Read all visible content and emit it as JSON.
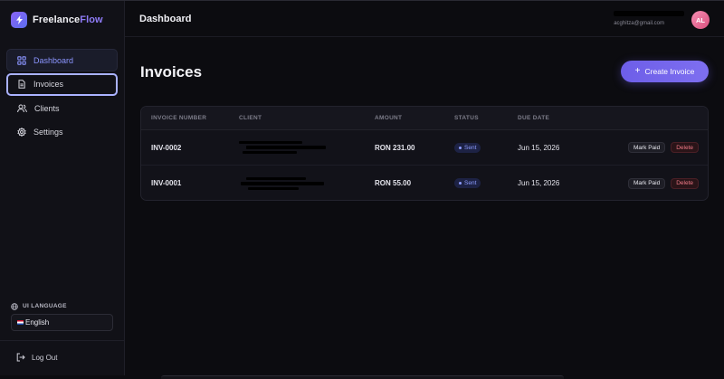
{
  "brand": {
    "name_part1": "Freelance",
    "name_part2": "Flow",
    "logo_icon": "lightning-icon"
  },
  "nav": {
    "items": [
      {
        "label": "Dashboard",
        "icon": "dashboard-grid-icon",
        "state": "active"
      },
      {
        "label": "Invoices",
        "icon": "document-icon",
        "state": "focused"
      },
      {
        "label": "Clients",
        "icon": "users-icon",
        "state": "default"
      },
      {
        "label": "Settings",
        "icon": "gear-icon",
        "state": "default"
      }
    ]
  },
  "language": {
    "label": "UI LANGUAGE",
    "selected": "English",
    "icon": "globe-icon"
  },
  "logout": {
    "label": "Log Out",
    "icon": "logout-icon"
  },
  "header": {
    "title": "Dashboard"
  },
  "user": {
    "email": "acghitza@gmail.com",
    "initials": "AL"
  },
  "main": {
    "title": "Invoices",
    "create_button": "Create Invoice"
  },
  "table": {
    "headers": {
      "number": "INVOICE NUMBER",
      "client": "CLIENT",
      "amount": "AMOUNT",
      "status": "STATUS",
      "due_date": "DUE DATE"
    },
    "rows": [
      {
        "number": "INV-0002",
        "amount": "RON 231.00",
        "status": "Sent",
        "due_date": "Jun 15, 2026",
        "mark_paid": "Mark Paid",
        "delete": "Delete"
      },
      {
        "number": "INV-0001",
        "amount": "RON 55.00",
        "status": "Sent",
        "due_date": "Jun 15, 2026",
        "mark_paid": "Mark Paid",
        "delete": "Delete"
      }
    ]
  },
  "colors": {
    "accent": "#6d5ee8",
    "active_nav_text": "#8b95ff",
    "status_sent": "#8d9cff",
    "delete": "#f07a86"
  }
}
